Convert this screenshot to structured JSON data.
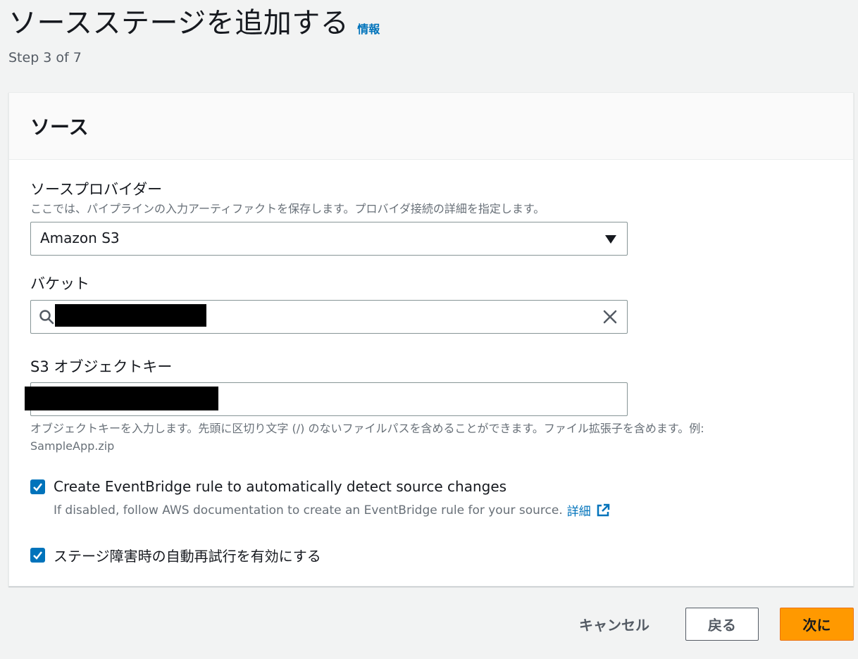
{
  "header": {
    "title": "ソースステージを追加する",
    "info_link": "情報",
    "step": "Step 3 of 7"
  },
  "panel": {
    "title": "ソース",
    "source_provider": {
      "label": "ソースプロバイダー",
      "description": "ここでは、パイプラインの入力アーティファクトを保存します。プロバイダ接続の詳細を指定します。",
      "selected": "Amazon S3"
    },
    "bucket": {
      "label": "バケット"
    },
    "object_key": {
      "label": "S3 オブジェクトキー",
      "description_line1": "オブジェクトキーを入力します。先頭に区切り文字 (/) のないファイルパスを含めることができます。ファイル拡張子を含めます。例:",
      "description_line2": "SampleApp.zip"
    },
    "eventbridge": {
      "checked": true,
      "label": "Create EventBridge rule to automatically detect source changes",
      "description": "If disabled, follow AWS documentation to create an EventBridge rule for your source.",
      "more_link": "詳細"
    },
    "retry": {
      "checked": true,
      "label": "ステージ障害時の自動再試行を有効にする"
    }
  },
  "footer": {
    "cancel": "キャンセル",
    "back": "戻る",
    "next": "次に"
  },
  "colors": {
    "accent": "#0073bb",
    "primary_button": "#ff9900",
    "background": "#f2f3f3"
  }
}
